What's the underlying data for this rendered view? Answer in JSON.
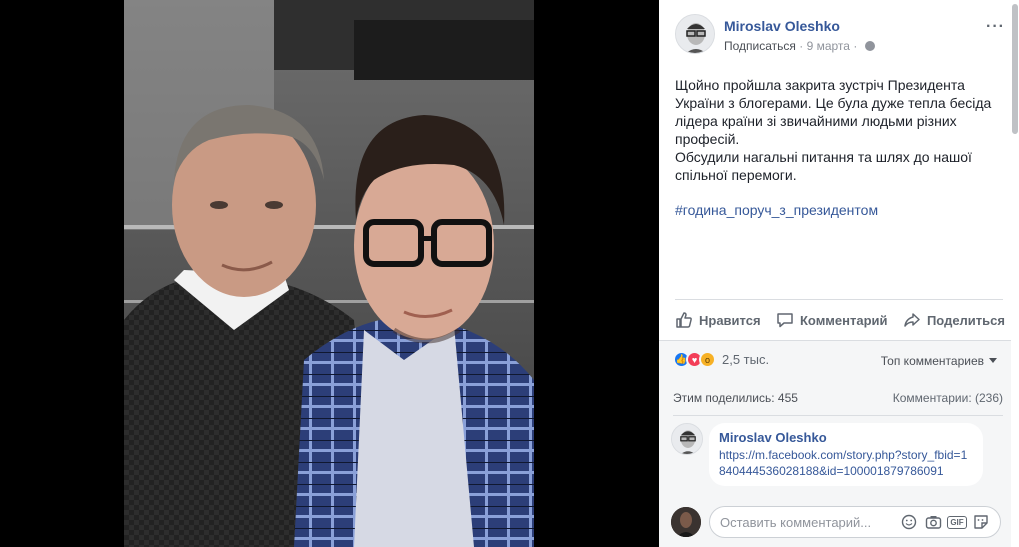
{
  "post": {
    "author": "Miroslav Oleshko",
    "subscribe": "Подписаться",
    "separator": "·",
    "date": "9 марта",
    "separator2": "·",
    "more": "···",
    "text_lines": [
      "Щойно пройшла закрита зустріч Президента",
      "України з блогерами. Це була дуже тепла бесіда",
      "лідера країни зі звичайними людьми різних",
      "професій.",
      "Обсудили нагальні питання та шлях до нашої",
      "спільної перемоги."
    ],
    "hashtag": "#година_поруч_з_президентом"
  },
  "actions": {
    "like": "Нравится",
    "comment": "Комментарий",
    "share": "Поделиться"
  },
  "reactions": {
    "count": "2,5 тыс.",
    "types": [
      "like",
      "love",
      "wow"
    ],
    "sort_label": "Топ комментариев"
  },
  "stats": {
    "shares": "Этим поделились: 455",
    "comments": "Комментарии: (236)"
  },
  "comment": {
    "author": "Miroslav Oleshko",
    "link": "https://m.facebook.com/story.php?story_fbid=1840444536028188&id=100001879786091"
  },
  "composer": {
    "placeholder": "Оставить комментарий..."
  },
  "colors": {
    "link": "#365899",
    "like": "#1877f2",
    "love": "#f33e58",
    "wow": "#f7b125"
  }
}
